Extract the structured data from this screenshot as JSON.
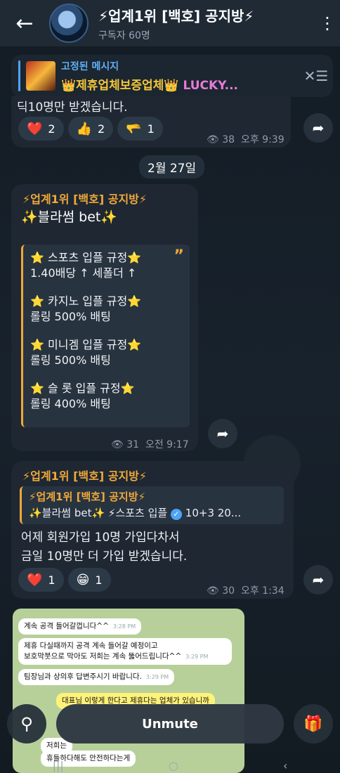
{
  "header": {
    "title": "⚡업계1위 [백호] 공지방⚡",
    "subscribers": "구독자 60명",
    "back_icon": "arrow-left-icon",
    "menu_icon": "more-vertical-icon"
  },
  "pinned": {
    "label": "고정된 메시지",
    "text": "👑제휴업체보증업체👑",
    "lucky": "LUCKY...",
    "icon": "pin-list-icon"
  },
  "top_message": {
    "text": "딕10명만 받겠습니다.",
    "reactions": [
      {
        "emoji": "❤️",
        "count": "2"
      },
      {
        "emoji": "👍",
        "count": "2"
      },
      {
        "emoji": "🫳",
        "count": "1"
      }
    ],
    "views": "38",
    "time": "오후 9:39"
  },
  "date_separator": "2월 27일",
  "message2": {
    "sender": "⚡업계1위 [백호] 공지방⚡",
    "headline": "✨블라썸 bet✨",
    "quote_lines": [
      "⭐ 스포츠 입플 규정⭐",
      "1.40배당 ↑ 세폴더 ↑",
      "",
      "⭐ 카지노 입플 규정⭐",
      "롤링 500% 배팅",
      "",
      "⭐ 미니겜 입플 규정⭐",
      "롤링 500% 배팅",
      "",
      "⭐ 슬  롯 입플 규정⭐",
      "롤링 400% 배팅"
    ],
    "views": "31",
    "time": "오전 9:17"
  },
  "message3": {
    "sender": "⚡업계1위 [백호] 공지방⚡",
    "forward_sender": "⚡업계1위 [백호] 공지방⚡",
    "forward_body": "✨블라썸 bet✨ ⚡스포츠 입플",
    "forward_tail": "10+3 20...",
    "body_line1": "어제 회원가입 10명 가입다차서",
    "body_line2": "금일 10명만 더 가입 받겠습니다.",
    "reactions": [
      {
        "emoji": "❤️",
        "count": "1"
      },
      {
        "emoji": "😁",
        "count": "1"
      }
    ],
    "views": "30",
    "time": "오후 1:34"
  },
  "screenshot": {
    "messages": [
      {
        "text": "계속 공격 들어갈껍니다^^",
        "time": "3:28 PM"
      },
      {
        "text": "제휴 다실때까지 공격 계속 들어갈 예정이고",
        "time": ""
      },
      {
        "text": "보호막붓으로 막아도 저희는 계속 뚫어드립니다^^",
        "time": "3:29 PM"
      },
      {
        "text": "팀장님과 상의후 답변주시기 바랍니다.",
        "time": "3:29 PM"
      },
      {
        "text": "대표님 이렇게 한다고 제휴다는 업체가 있습니까",
        "time": ""
      },
      {
        "text": "저희는",
        "time": ""
      },
      {
        "text": "휴들하다해도 안전하다는게",
        "time": ""
      }
    ]
  },
  "bottom": {
    "unmute": "Unmute",
    "search_icon": "search-icon",
    "gift_icon": "gift-icon"
  }
}
